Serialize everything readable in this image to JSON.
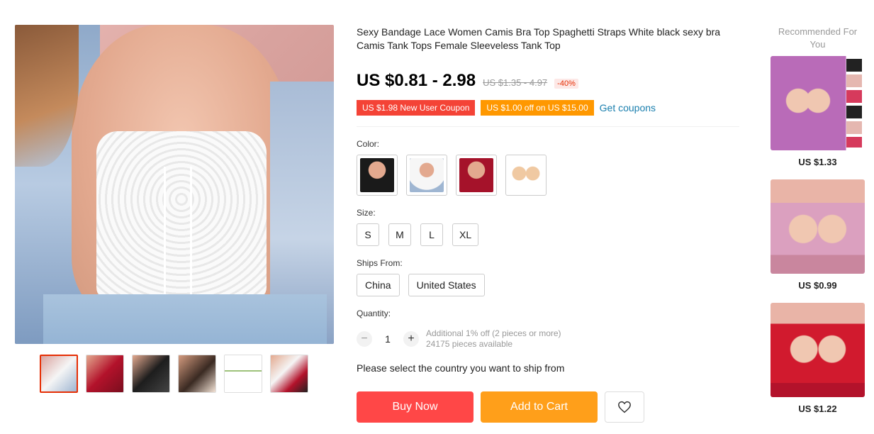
{
  "product": {
    "title": "Sexy Bandage Lace Women Camis Bra Top Spaghetti Straps White black sexy bra Camis Tank Tops Female Sleeveless Tank Top",
    "price": "US $0.81 - 2.98",
    "old_price": "US $1.35 - 4.97",
    "discount": "-40%"
  },
  "coupons": {
    "new_user": "US $1.98 New User Coupon",
    "offer": "US $1.00 off on US $15.00",
    "link": "Get coupons"
  },
  "options": {
    "color_label": "Color:",
    "colors": [
      "black-lace-top",
      "white-lace-top",
      "red-lace-top",
      "nude-nipple-covers"
    ],
    "size_label": "Size:",
    "sizes": [
      "S",
      "M",
      "L",
      "XL"
    ],
    "ships_label": "Ships From:",
    "ships_from": [
      "China",
      "United States"
    ]
  },
  "quantity": {
    "label": "Quantity:",
    "value": "1",
    "minus": "−",
    "plus": "+",
    "info_line1": "Additional 1% off (2 pieces or more)",
    "info_line2": "24175 pieces available"
  },
  "ship_message": "Please select the country you want to ship from",
  "actions": {
    "buy_now": "Buy Now",
    "add_to_cart": "Add to Cart",
    "wishlist_icon": "heart-icon"
  },
  "recommended": {
    "title": "Recommended For You",
    "items": [
      {
        "price": "US $1.33"
      },
      {
        "price": "US $0.99"
      },
      {
        "price": "US $1.22"
      }
    ]
  },
  "colors": {
    "accent_red": "#ff4747",
    "accent_orange": "#ff9f1a",
    "coupon_red": "#f44336",
    "coupon_orange": "#ff9800",
    "link_blue": "#1a7fae"
  }
}
